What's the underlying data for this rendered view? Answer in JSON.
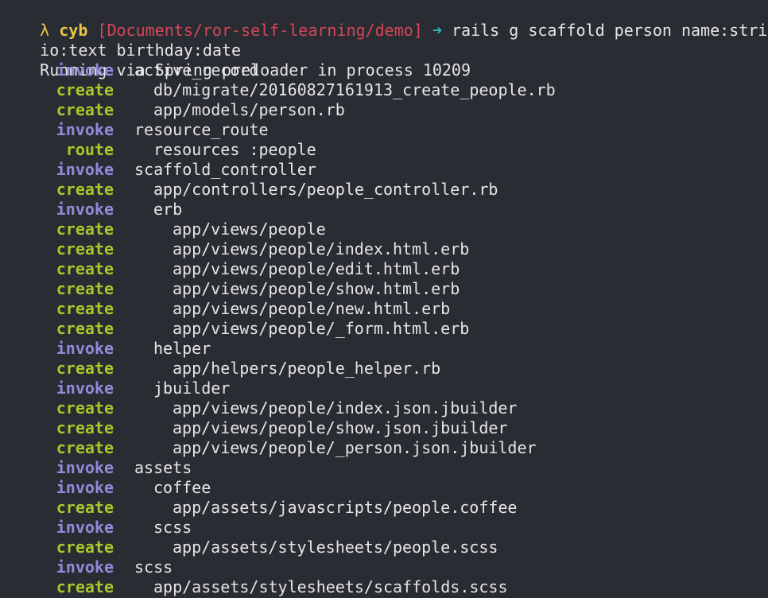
{
  "prompt": {
    "symbol": "λ",
    "user": "cyb",
    "directory": "[Documents/ror-self-learning/demo]",
    "arrow": "➜",
    "command_part1": "rails g scaffold person name:string b",
    "command_part2": "io:text birthday:date"
  },
  "status_line": "Running via Spring preloader in process 10209",
  "colors": {
    "background": "#2a2c33",
    "invoke": "#8f8cda",
    "create": "#a9c62b",
    "prompt_user": "#e7c547",
    "prompt_dir": "#d4475a",
    "prompt_arrow": "#2bbcb4",
    "text": "#e6e6e6"
  },
  "output": [
    {
      "action": "invoke",
      "target": "active_record",
      "indent": 0
    },
    {
      "action": "create",
      "target": "db/migrate/20160827161913_create_people.rb",
      "indent": 1
    },
    {
      "action": "create",
      "target": "app/models/person.rb",
      "indent": 1
    },
    {
      "action": "invoke",
      "target": "resource_route",
      "indent": 0
    },
    {
      "action": "route",
      "target": "resources :people",
      "indent": 1
    },
    {
      "action": "invoke",
      "target": "scaffold_controller",
      "indent": 0
    },
    {
      "action": "create",
      "target": "app/controllers/people_controller.rb",
      "indent": 1
    },
    {
      "action": "invoke",
      "target": "erb",
      "indent": 1
    },
    {
      "action": "create",
      "target": "app/views/people",
      "indent": 2
    },
    {
      "action": "create",
      "target": "app/views/people/index.html.erb",
      "indent": 2
    },
    {
      "action": "create",
      "target": "app/views/people/edit.html.erb",
      "indent": 2
    },
    {
      "action": "create",
      "target": "app/views/people/show.html.erb",
      "indent": 2
    },
    {
      "action": "create",
      "target": "app/views/people/new.html.erb",
      "indent": 2
    },
    {
      "action": "create",
      "target": "app/views/people/_form.html.erb",
      "indent": 2
    },
    {
      "action": "invoke",
      "target": "helper",
      "indent": 1
    },
    {
      "action": "create",
      "target": "app/helpers/people_helper.rb",
      "indent": 2
    },
    {
      "action": "invoke",
      "target": "jbuilder",
      "indent": 1
    },
    {
      "action": "create",
      "target": "app/views/people/index.json.jbuilder",
      "indent": 2
    },
    {
      "action": "create",
      "target": "app/views/people/show.json.jbuilder",
      "indent": 2
    },
    {
      "action": "create",
      "target": "app/views/people/_person.json.jbuilder",
      "indent": 2
    },
    {
      "action": "invoke",
      "target": "assets",
      "indent": 0
    },
    {
      "action": "invoke",
      "target": "coffee",
      "indent": 1
    },
    {
      "action": "create",
      "target": "app/assets/javascripts/people.coffee",
      "indent": 2
    },
    {
      "action": "invoke",
      "target": "scss",
      "indent": 1
    },
    {
      "action": "create",
      "target": "app/assets/stylesheets/people.scss",
      "indent": 2
    },
    {
      "action": "invoke",
      "target": "scss",
      "indent": 0
    },
    {
      "action": "create",
      "target": "app/assets/stylesheets/scaffolds.scss",
      "indent": 1
    }
  ]
}
